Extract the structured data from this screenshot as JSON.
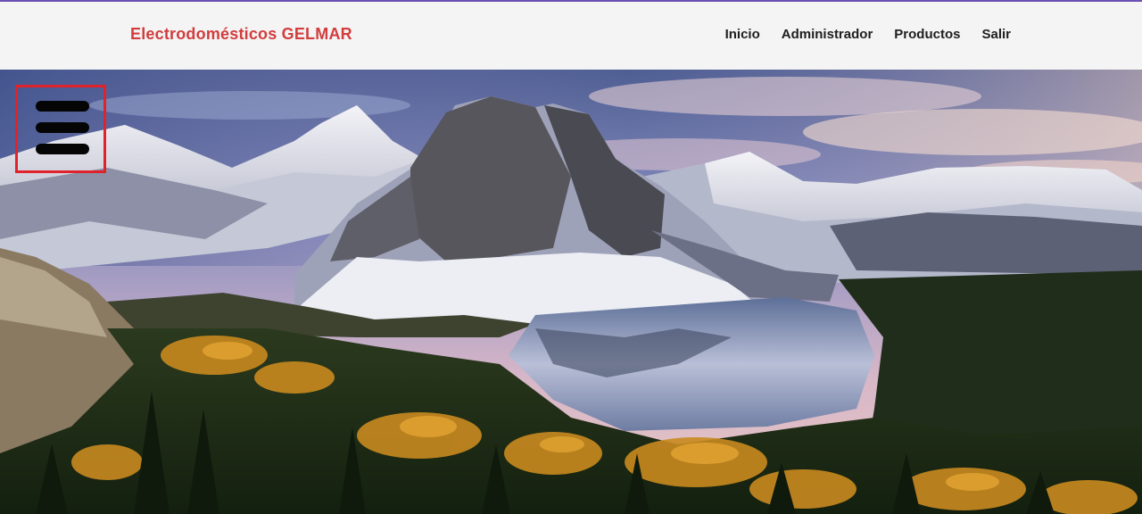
{
  "header": {
    "brand": "Electrodomésticos GELMAR",
    "nav": [
      {
        "label": "Inicio"
      },
      {
        "label": "Administrador"
      },
      {
        "label": "Productos"
      },
      {
        "label": "Salir"
      }
    ]
  },
  "menu_toggle": {
    "icon": "hamburger-menu-icon"
  },
  "colors": {
    "accent_line": "#6b4fb3",
    "brand": "#d23d3d",
    "toggle_border": "#e0232b",
    "navbar_bg": "#f4f4f4"
  }
}
